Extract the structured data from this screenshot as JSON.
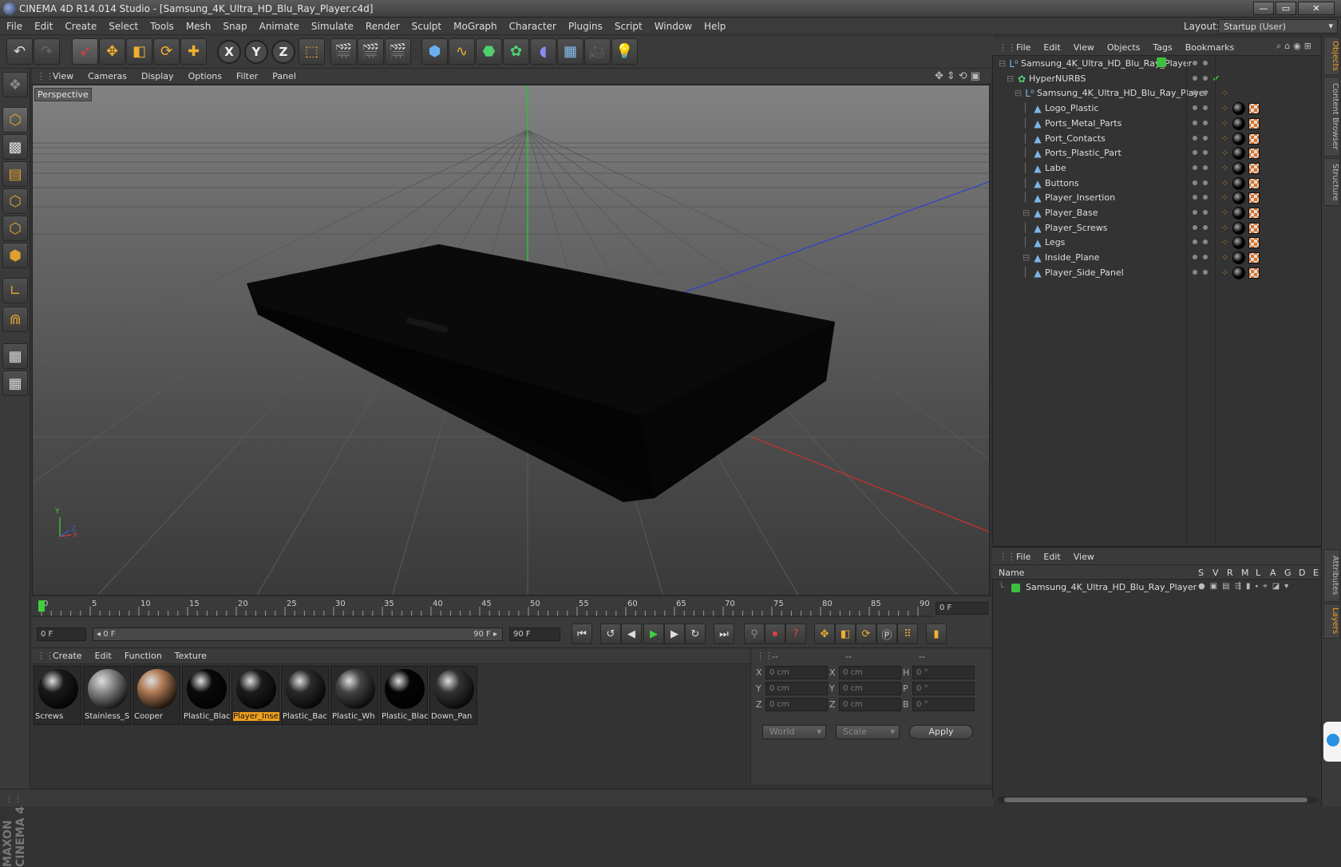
{
  "window": {
    "title": "CINEMA 4D R14.014 Studio - [Samsung_4K_Ultra_HD_Blu_Ray_Player.c4d]",
    "buttons": [
      "—",
      "▭",
      "✕"
    ]
  },
  "menu": [
    "File",
    "Edit",
    "Create",
    "Select",
    "Tools",
    "Mesh",
    "Snap",
    "Animate",
    "Simulate",
    "Render",
    "Sculpt",
    "MoGraph",
    "Character",
    "Plugins",
    "Script",
    "Window",
    "Help"
  ],
  "layout": {
    "label": "Layout:",
    "value": "Startup (User)"
  },
  "toolbar": {
    "axis_x": "X",
    "axis_y": "Y",
    "axis_z": "Z"
  },
  "viewport": {
    "menu": [
      "View",
      "Cameras",
      "Display",
      "Options",
      "Filter",
      "Panel"
    ],
    "label": "Perspective",
    "axis_y": "Y",
    "axis_x": "X",
    "axis_z": "Z"
  },
  "timeline": {
    "ticks": [
      "0",
      "5",
      "10",
      "15",
      "20",
      "25",
      "30",
      "35",
      "40",
      "45",
      "50",
      "55",
      "60",
      "65",
      "70",
      "75",
      "80",
      "85",
      "90"
    ],
    "frame_field": "0 F"
  },
  "transport": {
    "start": "0 F",
    "range_start": "◂ 0 F",
    "range_end": "90 F ▸",
    "end": "90 F"
  },
  "materials": {
    "menu": [
      "Create",
      "Edit",
      "Function",
      "Texture"
    ],
    "items": [
      {
        "label": "Screws",
        "color": "#1a1a1a"
      },
      {
        "label": "Stainless_S",
        "color": "#8a8a8a"
      },
      {
        "label": "Cooper",
        "color": "#b07a55"
      },
      {
        "label": "Plastic_Blac",
        "color": "#0a0a0a"
      },
      {
        "label": "Player_Inse",
        "color": "#1c1c1c"
      },
      {
        "label": "Plastic_Bac",
        "color": "#2a2a2a"
      },
      {
        "label": "Plastic_Wh",
        "color": "#444444"
      },
      {
        "label": "Plastic_Blac",
        "color": "#050505"
      },
      {
        "label": "Down_Pan",
        "color": "#333333"
      }
    ]
  },
  "coords": {
    "headers": [
      "--",
      "--",
      "--"
    ],
    "rows": [
      {
        "a": "X",
        "av": "0 cm",
        "b": "X",
        "bv": "0 cm",
        "c": "H",
        "cv": "0 °"
      },
      {
        "a": "Y",
        "av": "0 cm",
        "b": "Y",
        "bv": "0 cm",
        "c": "P",
        "cv": "0 °"
      },
      {
        "a": "Z",
        "av": "0 cm",
        "b": "Z",
        "bv": "0 cm",
        "c": "B",
        "cv": "0 °"
      }
    ],
    "world": "World",
    "scale": "Scale",
    "apply": "Apply"
  },
  "objects": {
    "menu": [
      "File",
      "Edit",
      "View",
      "Objects",
      "Tags",
      "Bookmarks"
    ],
    "items": [
      {
        "name": "Samsung_4K_Ultra_HD_Blu_Ray_Player",
        "indent": 0
      },
      {
        "name": "HyperNURBS",
        "indent": 1
      },
      {
        "name": "Samsung_4K_Ultra_HD_Blu_Ray_Player",
        "indent": 2
      },
      {
        "name": "Logo_Plastic",
        "indent": 3
      },
      {
        "name": "Ports_Metal_Parts",
        "indent": 3
      },
      {
        "name": "Port_Contacts",
        "indent": 3
      },
      {
        "name": "Ports_Plastic_Part",
        "indent": 3
      },
      {
        "name": "Labe",
        "indent": 3
      },
      {
        "name": "Buttons",
        "indent": 3
      },
      {
        "name": "Player_Insertion",
        "indent": 3
      },
      {
        "name": "Player_Base",
        "indent": 3
      },
      {
        "name": "Player_Screws",
        "indent": 3
      },
      {
        "name": "Legs",
        "indent": 3
      },
      {
        "name": "Inside_Plane",
        "indent": 3
      },
      {
        "name": "Player_Side_Panel",
        "indent": 3
      }
    ]
  },
  "layers": {
    "menu": [
      "File",
      "Edit",
      "View"
    ],
    "header_name": "Name",
    "columns": [
      "S",
      "V",
      "R",
      "M",
      "L",
      "A",
      "G",
      "D",
      "E"
    ],
    "items": [
      {
        "name": "Samsung_4K_Ultra_HD_Blu_Ray_Player",
        "color": "#3fbf3f"
      }
    ]
  },
  "righttabs": [
    "Objects",
    "Content Browser",
    "Structure",
    "Attributes",
    "Layers"
  ],
  "maxon": "MAXON CINEMA 4D"
}
